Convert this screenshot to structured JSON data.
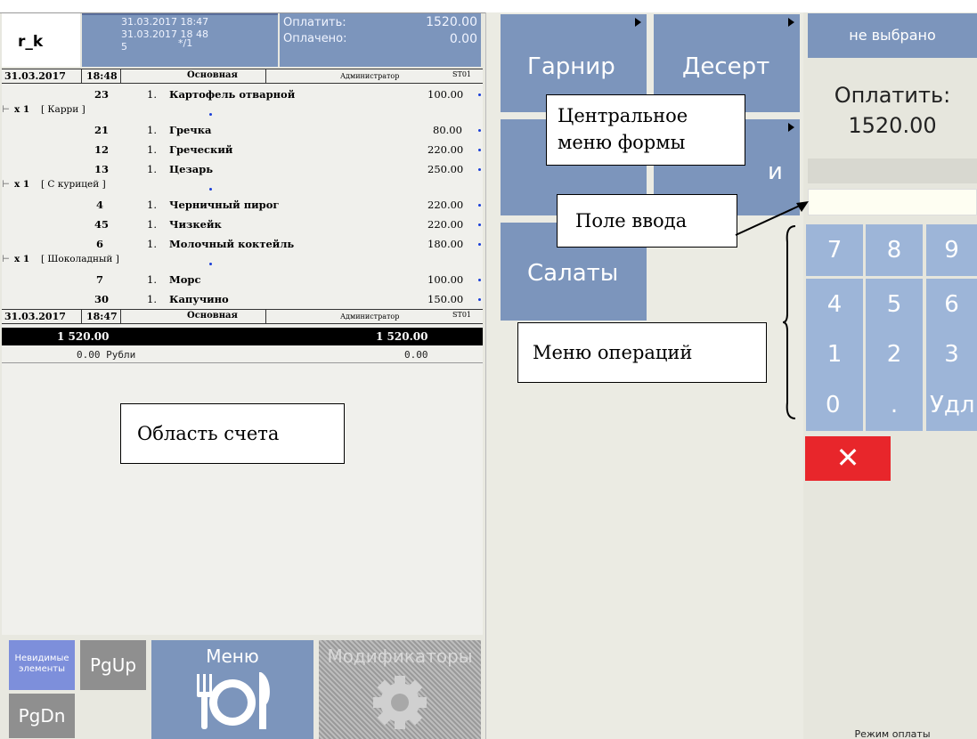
{
  "header": {
    "app_name": "r_k",
    "info": {
      "opened": "31.03.2017 18:47",
      "printed": "31.03.2017 18 48",
      "guests": "5",
      "table": "*/1"
    },
    "to_pay_label": "Оплатить:",
    "to_pay_value": "1520.00",
    "paid_label": "Оплачено:",
    "paid_value": "0.00"
  },
  "receipt": {
    "top_header": {
      "date": "31.03.2017",
      "time": "18:48",
      "menu": "Основная",
      "user": "Администратор",
      "station": "ST01"
    },
    "items": [
      {
        "code": "23",
        "qty": "1.",
        "name": "Картофель отварной",
        "price": "100.00"
      },
      {
        "code": "21",
        "qty": "1.",
        "name": "Гречка",
        "price": "80.00"
      },
      {
        "code": "12",
        "qty": "1.",
        "name": "Греческий",
        "price": "220.00"
      },
      {
        "code": "13",
        "qty": "1.",
        "name": "Цезарь",
        "price": "250.00"
      },
      {
        "code": "4",
        "qty": "1.",
        "name": "Черничный пирог",
        "price": "220.00"
      },
      {
        "code": "45",
        "qty": "1.",
        "name": "Чизкейк",
        "price": "220.00"
      },
      {
        "code": "6",
        "qty": "1.",
        "name": "Молочный коктейль",
        "price": "180.00"
      },
      {
        "code": "7",
        "qty": "1.",
        "name": "Морс",
        "price": "100.00"
      },
      {
        "code": "30",
        "qty": "1.",
        "name": "Капучино",
        "price": "150.00"
      }
    ],
    "modifiers": [
      {
        "qty": "x 1",
        "name": "[ Карри ]"
      },
      {
        "qty": "x 1",
        "name": "[ С курицей ]"
      },
      {
        "qty": "x 1",
        "name": "[ Шоколадный ]"
      }
    ],
    "bottom_header": {
      "date": "31.03.2017",
      "time": "18:47",
      "menu": "Основная",
      "user": "Администратор",
      "station": "ST01"
    },
    "total_left": "1 520.00",
    "total_right": "1 520.00",
    "paid_left": "0.00 Рубли",
    "paid_right": "0.00"
  },
  "bottom_buttons": {
    "invisible": "Невидимые элементы",
    "pgup": "PgUp",
    "pgdn": "PgDn",
    "menu": "Меню",
    "modifiers": "Модификаторы"
  },
  "center_menu": {
    "tiles": [
      "Гарнир",
      "Десерт",
      "Салаты"
    ],
    "partial_tile": "и"
  },
  "right_panel": {
    "not_selected": "не выбрано",
    "pay_label": "Оплатить:",
    "pay_amount": "1520.00",
    "keys": [
      "7",
      "8",
      "9",
      "4",
      "5",
      "6",
      "1",
      "2",
      "3",
      "0",
      ".",
      "Удл"
    ],
    "cancel_symbol": "✕",
    "mode_label": "Режим оплаты"
  },
  "annotations": {
    "center_menu_note": "Центральное меню формы",
    "input_note": "Поле ввода",
    "ops_note": "Меню операций",
    "bill_note": "Область счета"
  },
  "colors": {
    "tile_blue": "#7c95bc",
    "key_blue": "#9db5d8",
    "cancel_red": "#e8262b",
    "dot_blue": "#1a3ed8"
  }
}
